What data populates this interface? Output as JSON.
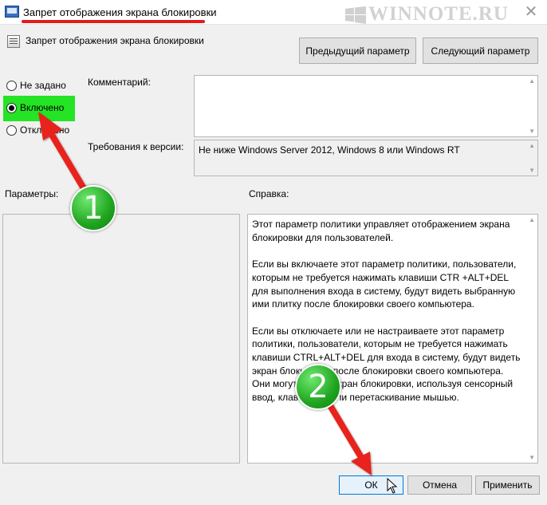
{
  "window": {
    "title": "Запрет отображения экрана блокировки",
    "watermark": "WINNOTE.RU",
    "close_glyph": "✕"
  },
  "header": {
    "title": "Запрет отображения экрана блокировки",
    "prev_label": "Предыдущий параметр",
    "next_label": "Следующий параметр"
  },
  "state": {
    "options": [
      {
        "label": "Не задано",
        "checked": false
      },
      {
        "label": "Включено",
        "checked": true
      },
      {
        "label": "Отключено",
        "checked": false
      }
    ]
  },
  "comment": {
    "label": "Комментарий:",
    "value": ""
  },
  "version": {
    "label": "Требования к версии:",
    "value": "Не ниже Windows Server 2012, Windows 8 или Windows RT"
  },
  "params": {
    "label": "Параметры:"
  },
  "help": {
    "label": "Справка:",
    "paragraphs": [
      "Этот параметр политики управляет отображением экрана блокировки для пользователей.",
      "Если вы включаете этот параметр политики, пользователи, которым не требуется нажимать клавиши CTR +ALT+DEL для выполнения входа в систему, будут видеть выбранную ими плитку после блокировки своего компьютера.",
      "Если вы отключаете или не настраиваете этот параметр политики, пользователи, которым не требуется нажимать клавиши CTRL+ALT+DEL для входа в систему, будут видеть экран блокировки после блокировки своего компьютера. Они могут убрать экран блокировки, используя сенсорный ввод, клавиатуру или перетаскивание мышью."
    ]
  },
  "footer": {
    "ok_label": "ОК",
    "cancel_label": "Отмена",
    "apply_label": "Применить"
  },
  "annotations": {
    "badge1": "1",
    "badge2": "2",
    "arrow_color": "#e8231d",
    "highlight_color": "#25e425"
  }
}
